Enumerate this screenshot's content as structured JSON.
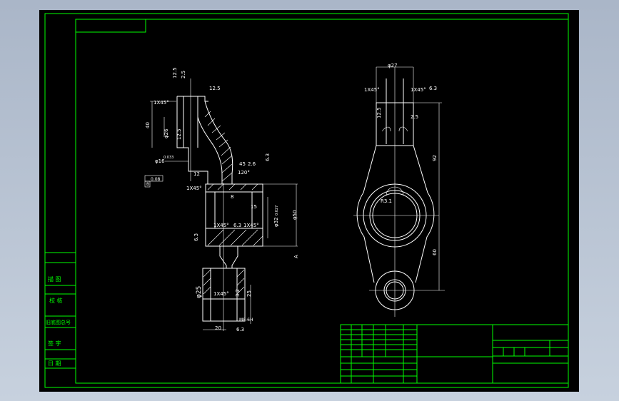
{
  "colors": {
    "viewport": "#b7c3d4",
    "sheet": "#000000",
    "frame": "#00ff00",
    "geometry": "#ffffff"
  },
  "side_view": {
    "dimensions": {
      "d_top": "12.5",
      "d_top2": "2.5",
      "ra_top": "12.5",
      "chamfer_top": "1X45°",
      "h40": "40",
      "phi26": "φ26",
      "ra_mid": "12.5",
      "phi16": "φ16",
      "tol_small": "0.033",
      "d12": "12",
      "flat_tol": "0.08",
      "chamfer_mid": "1X45°",
      "ra_right": "6.3",
      "a45": "45",
      "a26": "2.6",
      "angle120": "120°",
      "d8": "8",
      "d15": "15",
      "phi32": "φ32",
      "tol_bore": "0.027",
      "phi50": "φ50",
      "ch_low1": "1X45°",
      "ra_low": "6.3",
      "ch_low2": "1X45°",
      "ra_left": "6.3",
      "phi25": "φ25",
      "ch_bot": "1X45°",
      "ra32": "3.2",
      "d25": "25",
      "d20": "20",
      "thread": "M8-6H",
      "ra_bot": "6.3",
      "section": "A",
      "datum": "B"
    }
  },
  "front_view": {
    "dimensions": {
      "phi27": "φ27",
      "ch_left": "1X45°",
      "ch_right": "1X45°",
      "ra63": "6.3",
      "ra125": "12.5",
      "ra25": "2.5",
      "d92": "92",
      "r31": "R3.1",
      "d60": "60"
    }
  },
  "title_block_left": {
    "cells": [
      "描 图",
      "校 核",
      "旧底图总号",
      "签 字",
      "日 期"
    ]
  }
}
